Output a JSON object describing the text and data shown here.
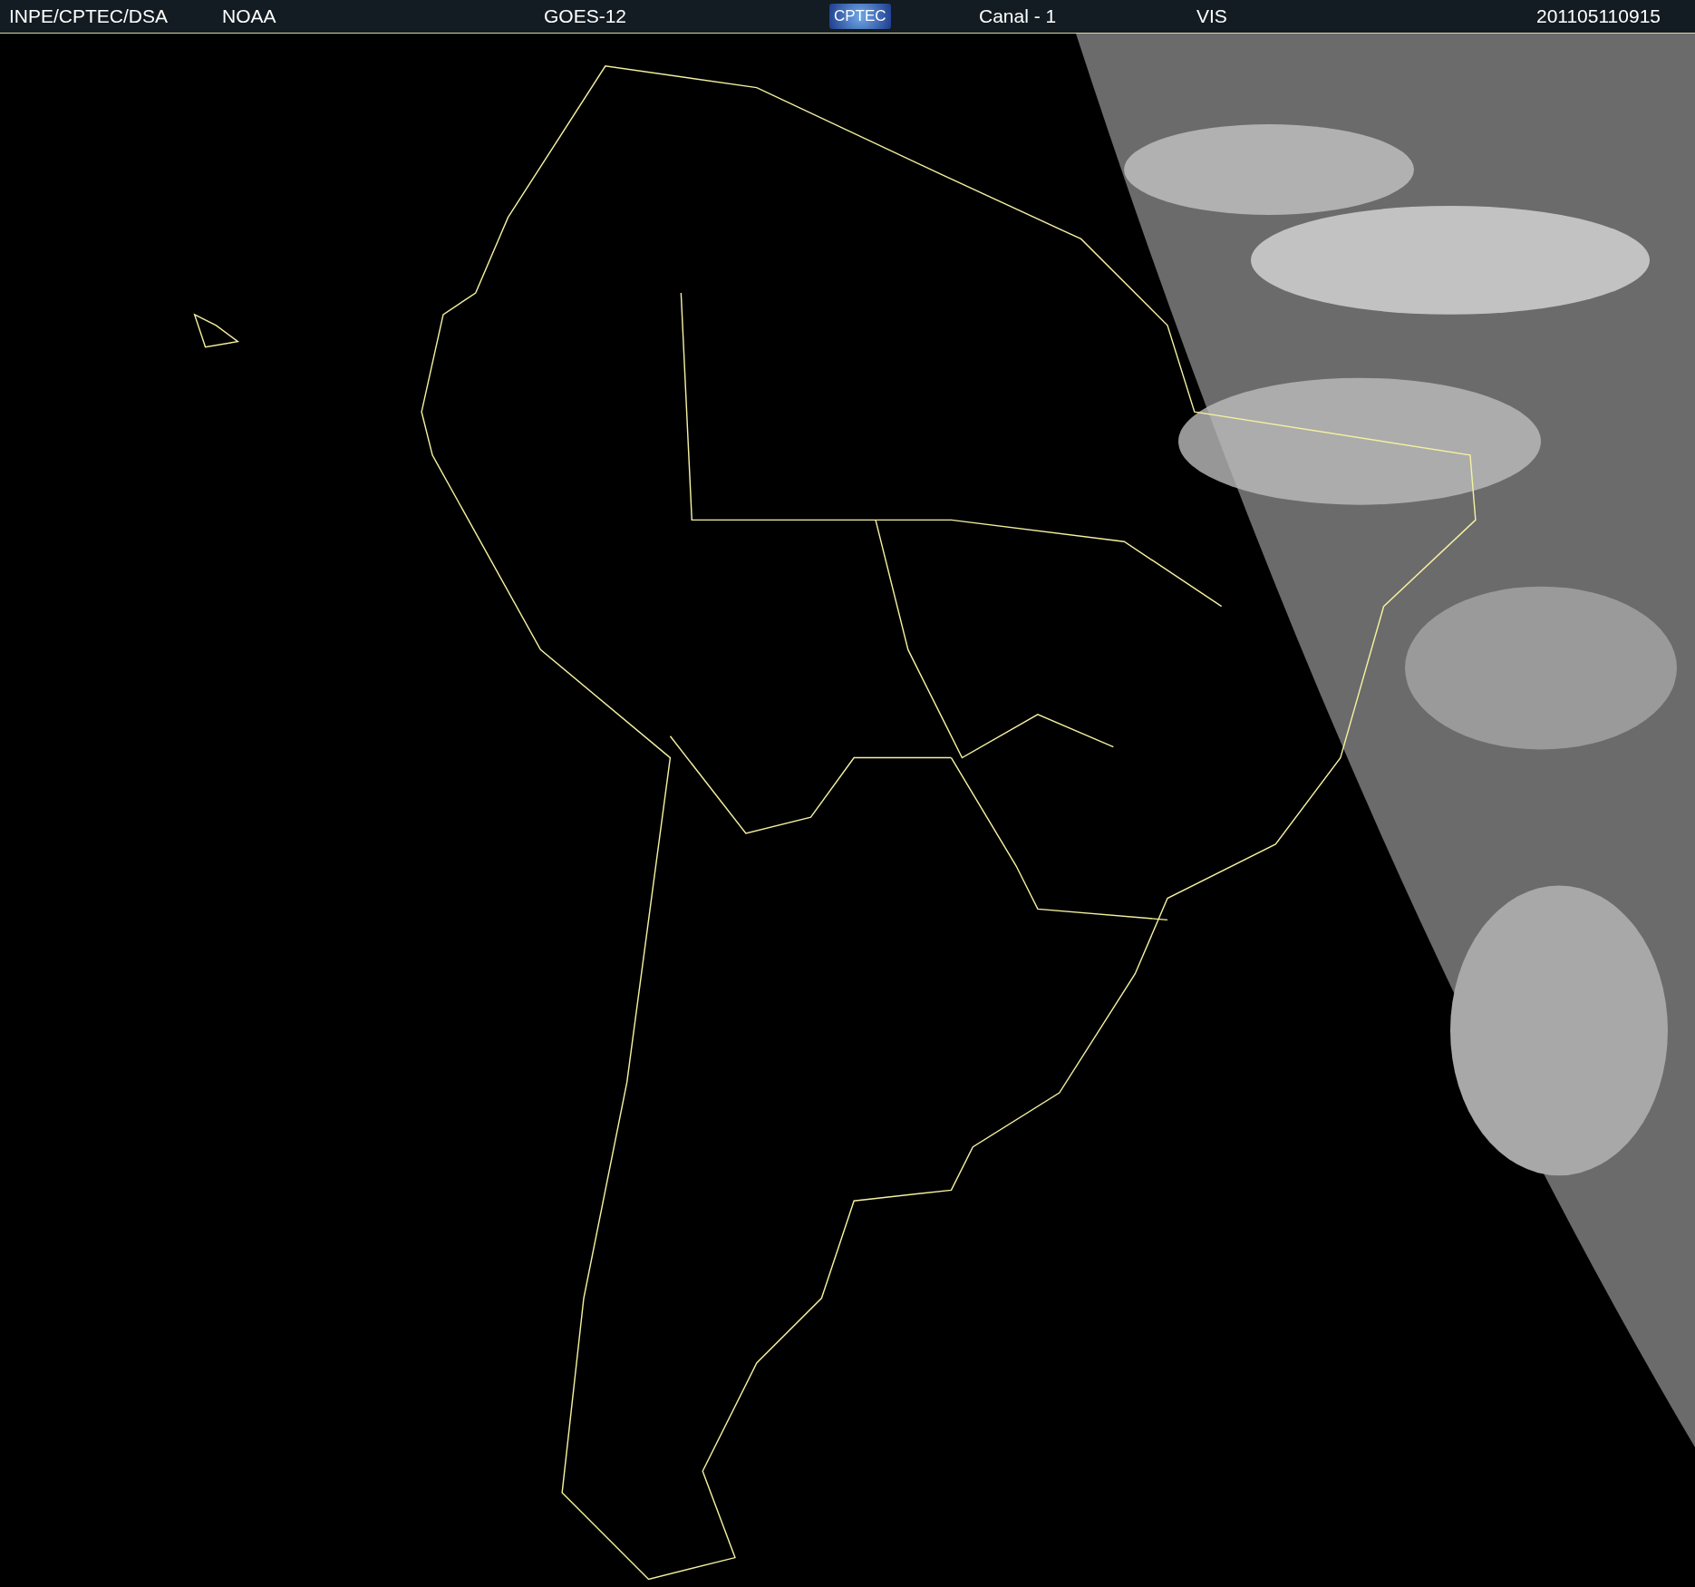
{
  "header": {
    "items": [
      {
        "kind": "text",
        "text": "INPE/CPTEC/DSA"
      },
      {
        "kind": "text",
        "text": "NOAA"
      },
      {
        "kind": "text",
        "text": "GOES-12"
      },
      {
        "kind": "logo",
        "text": "CPTEC"
      },
      {
        "kind": "text",
        "text": "Canal - 1"
      },
      {
        "kind": "text",
        "text": "VIS"
      },
      {
        "kind": "text",
        "text": "201105110915"
      }
    ]
  }
}
